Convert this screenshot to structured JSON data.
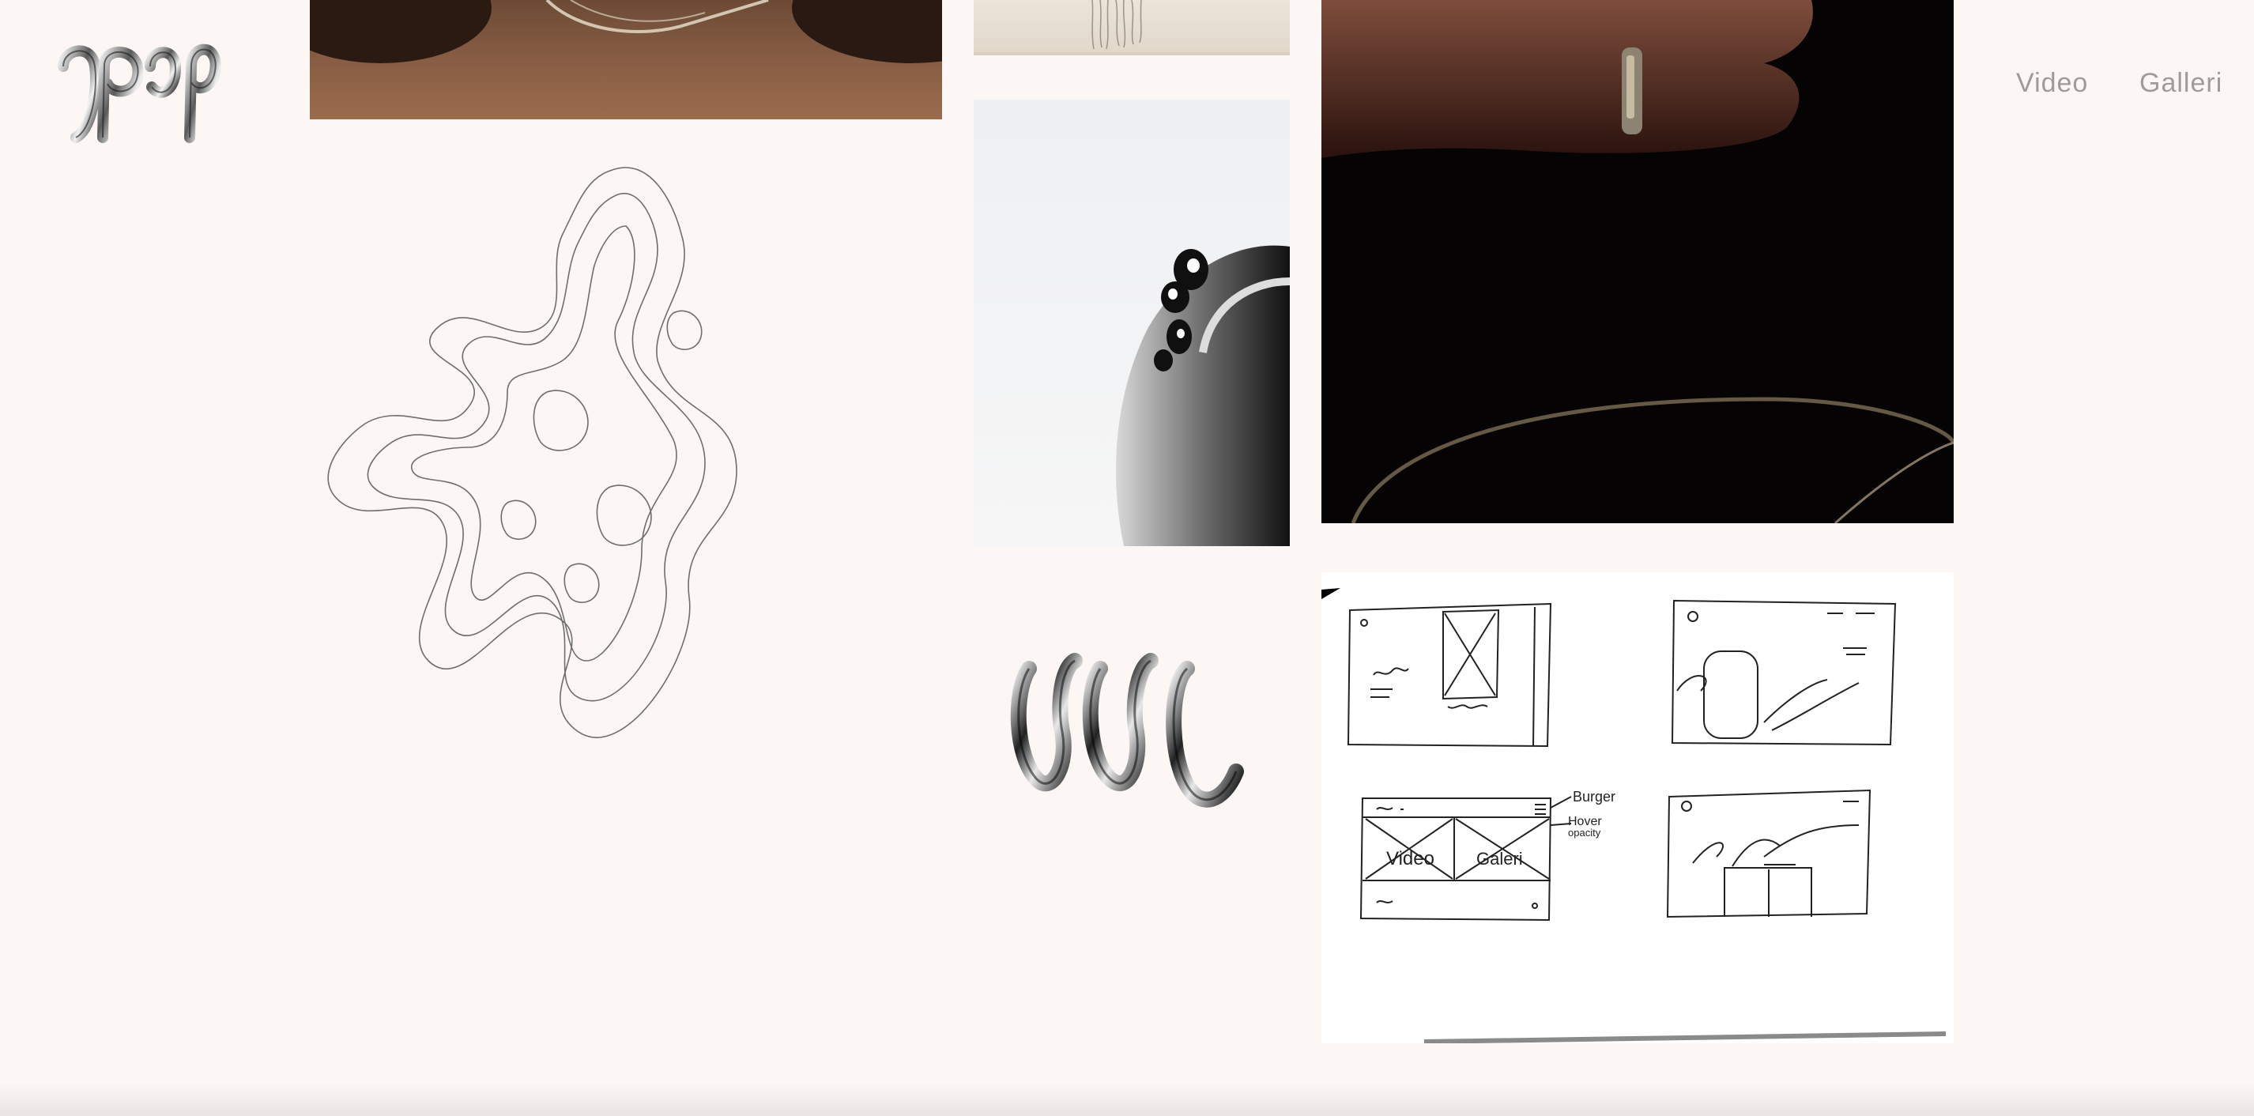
{
  "header": {
    "logo": {
      "icon": "chrome-letter-logo-icon"
    },
    "nav": [
      {
        "label": "Video"
      },
      {
        "label": "Galleri"
      }
    ]
  },
  "gallery": {
    "tiles": [
      {
        "name": "neck-photo",
        "icon": "photo"
      },
      {
        "name": "hair-photo",
        "icon": "photo"
      },
      {
        "name": "ring-on-finger-photo",
        "icon": "photo"
      },
      {
        "name": "inverted-ring-photo",
        "icon": "photo"
      },
      {
        "name": "marble-contour-drawing",
        "icon": "line-art"
      },
      {
        "name": "chrome-ccc-logo",
        "icon": "chrome-letters"
      },
      {
        "name": "wireframe-sketch",
        "icon": "sketch"
      }
    ],
    "sketch_notes": {
      "note_burger": "Burger",
      "note_hover": "Hover",
      "note_opacity": "opacity",
      "panel_video": "Video",
      "panel_galleri": "Galeri"
    }
  }
}
